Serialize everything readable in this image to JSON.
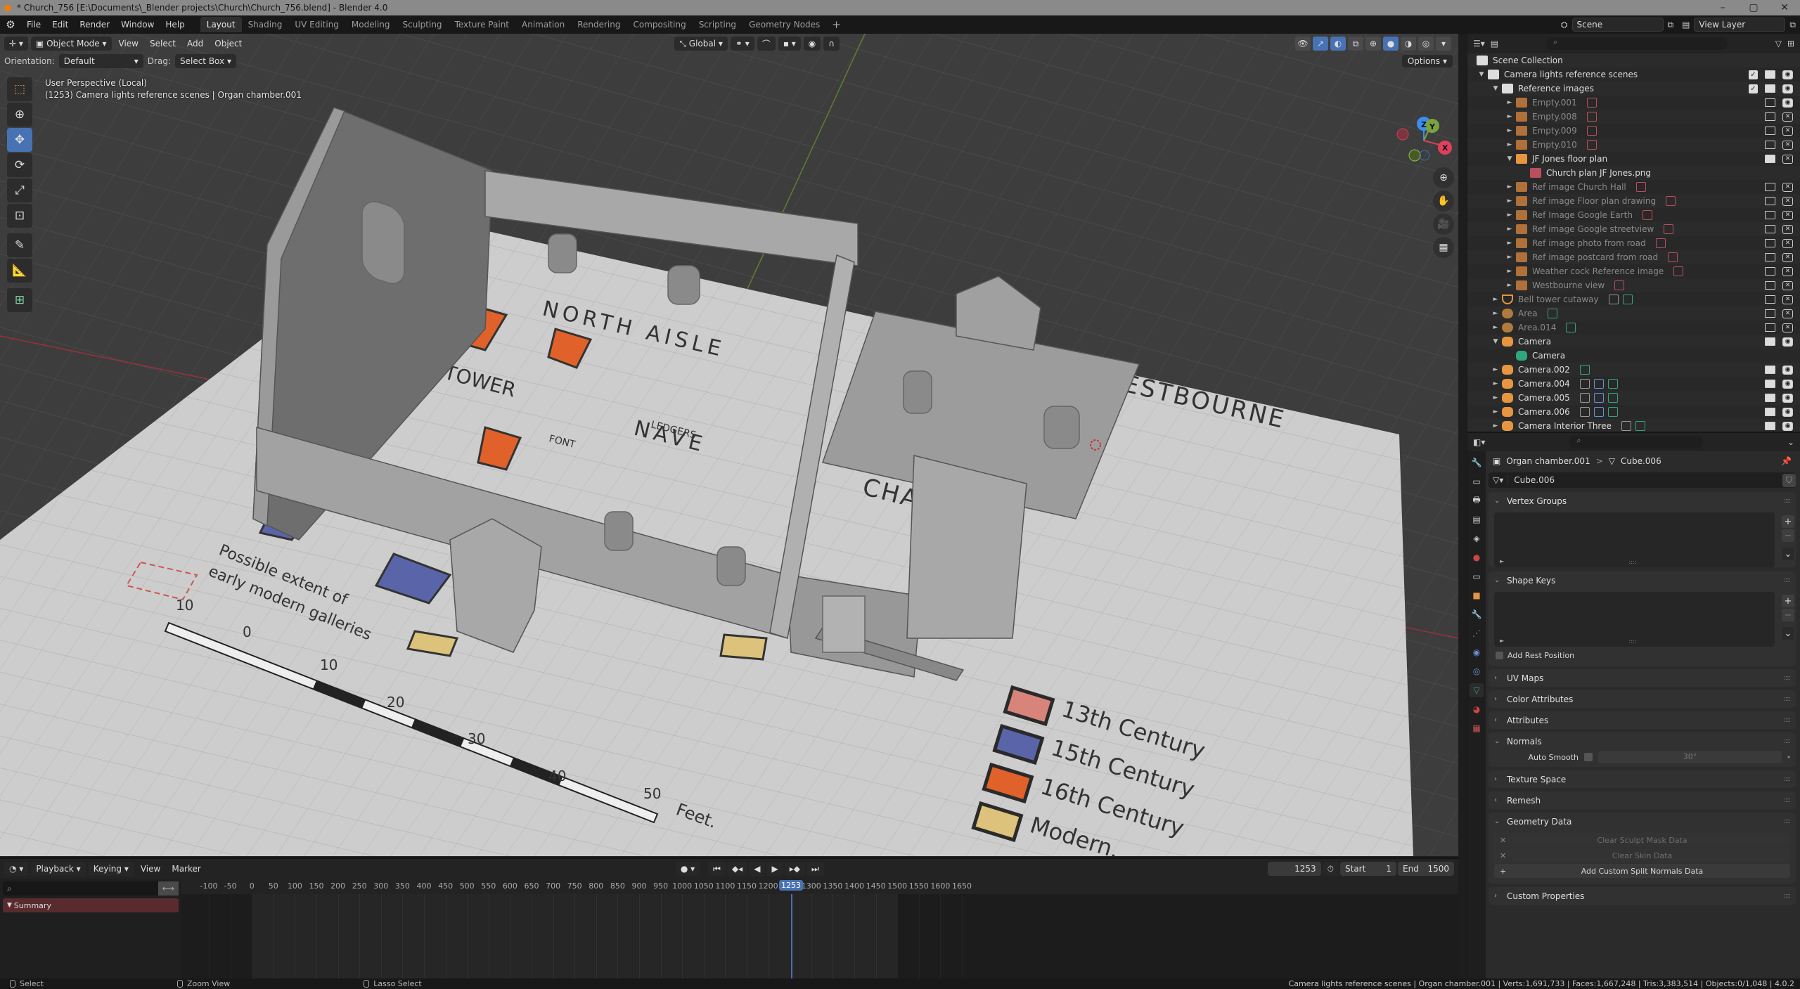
{
  "window": {
    "title": "* Church_756 [E:\\Documents\\_Blender projects\\Church\\Church_756.blend] - Blender 4.0",
    "controls": [
      "–",
      "▢",
      "✕"
    ]
  },
  "menubar": {
    "menus": [
      "File",
      "Edit",
      "Render",
      "Window",
      "Help"
    ],
    "workspaces": [
      "Layout",
      "Shading",
      "UV Editing",
      "Modeling",
      "Sculpting",
      "Texture Paint",
      "Animation",
      "Rendering",
      "Compositing",
      "Scripting",
      "Geometry Nodes"
    ],
    "active_workspace": "Layout",
    "add_workspace": "+",
    "scene": "Scene",
    "view_layer": "View Layer"
  },
  "viewport": {
    "mode": "Object Mode",
    "menus": [
      "View",
      "Select",
      "Add",
      "Object"
    ],
    "transform_orientation": "Global",
    "orientation_label": "Orientation:",
    "orientation_value": "Default",
    "drag_label": "Drag:",
    "drag_value": "Select Box",
    "options_label": "Options",
    "view_name": "User Perspective (Local)",
    "view_context": "(1253) Camera lights reference scenes | Organ chamber.001",
    "gizmo_axes": [
      "X",
      "Y",
      "Z"
    ],
    "scene_labels": {
      "north_aisle": "NORTH AISLE",
      "tower": "TOWER",
      "nave": "NAVE",
      "font": "FONT",
      "ledgers": "LEDGERS",
      "chancel": "CHANCEL",
      "westbourne": "WESTBOURNE",
      "galleries_note": [
        "Possible extent of",
        "early modern galleries"
      ],
      "scale_ticks": [
        "10",
        "0",
        "10",
        "20",
        "30",
        "40",
        "50"
      ],
      "scale_unit": "Feet."
    },
    "legend": [
      {
        "label": "13th Century",
        "color": "#d9847a"
      },
      {
        "label": "15th Century",
        "color": "#5a64a8"
      },
      {
        "label": "16th Century",
        "color": "#e0622a"
      },
      {
        "label": "Modern.",
        "color": "#dcc27a"
      }
    ]
  },
  "outliner": {
    "root": "Scene Collection",
    "rows": [
      {
        "label": "Camera lights reference scenes",
        "depth": 0,
        "expand": "▼",
        "icon": "collection",
        "dim": false,
        "check": true,
        "monitor": true,
        "camera": true
      },
      {
        "label": "Reference images",
        "depth": 1,
        "expand": "▼",
        "icon": "collection",
        "dim": false,
        "check": true,
        "monitor": true,
        "camera": true
      },
      {
        "label": "Empty.001",
        "depth": 2,
        "expand": "►",
        "icon": "image-empty",
        "dim": true,
        "extras": [
          "image-data"
        ],
        "monitor": false,
        "camera": true
      },
      {
        "label": "Empty.008",
        "depth": 2,
        "expand": "►",
        "icon": "image-empty",
        "dim": true,
        "extras": [
          "image-data"
        ],
        "monitor": false,
        "camera": false
      },
      {
        "label": "Empty.009",
        "depth": 2,
        "expand": "►",
        "icon": "image-empty",
        "dim": true,
        "extras": [
          "image-data"
        ],
        "monitor": false,
        "camera": false
      },
      {
        "label": "Empty.010",
        "depth": 2,
        "expand": "►",
        "icon": "image-empty",
        "dim": true,
        "extras": [
          "image-data"
        ],
        "monitor": false,
        "camera": false
      },
      {
        "label": "JF Jones floor plan",
        "depth": 2,
        "expand": "▼",
        "icon": "image-empty-active",
        "dim": false,
        "monitor": true,
        "camera": false
      },
      {
        "label": "Church plan JF Jones.png",
        "depth": 3,
        "expand": "",
        "icon": "image-data",
        "dim": false
      },
      {
        "label": "Ref image Church Hall",
        "depth": 2,
        "expand": "►",
        "icon": "image-empty",
        "dim": true,
        "extras": [
          "image-data"
        ],
        "monitor": false,
        "camera": false
      },
      {
        "label": "Ref image Floor plan drawing",
        "depth": 2,
        "expand": "►",
        "icon": "image-empty",
        "dim": true,
        "extras": [
          "image-data"
        ],
        "monitor": false,
        "camera": false
      },
      {
        "label": "Ref Image Google Earth",
        "depth": 2,
        "expand": "►",
        "icon": "image-empty",
        "dim": true,
        "extras": [
          "image-data"
        ],
        "monitor": false,
        "camera": false
      },
      {
        "label": "Ref image Google streetview",
        "depth": 2,
        "expand": "►",
        "icon": "image-empty",
        "dim": true,
        "extras": [
          "image-data"
        ],
        "monitor": false,
        "camera": false
      },
      {
        "label": "Ref image photo from road",
        "depth": 2,
        "expand": "►",
        "icon": "image-empty",
        "dim": true,
        "extras": [
          "image-data"
        ],
        "monitor": false,
        "camera": false
      },
      {
        "label": "Ref image postcard from road",
        "depth": 2,
        "expand": "►",
        "icon": "image-empty",
        "dim": true,
        "extras": [
          "image-data"
        ],
        "monitor": false,
        "camera": false
      },
      {
        "label": "Weather cock Reference image",
        "depth": 2,
        "expand": "►",
        "icon": "image-empty",
        "dim": true,
        "extras": [
          "image-data"
        ],
        "monitor": false,
        "camera": false
      },
      {
        "label": "Westbourne view",
        "depth": 2,
        "expand": "►",
        "icon": "image-empty",
        "dim": true,
        "extras": [
          "image-data"
        ],
        "monitor": false,
        "camera": false
      },
      {
        "label": "Bell tower cutaway",
        "depth": 1,
        "expand": "►",
        "icon": "mesh",
        "dim": true,
        "extras": [
          "modifier",
          "mesh-data"
        ],
        "monitor": false,
        "camera": false
      },
      {
        "label": "Area",
        "depth": 1,
        "expand": "►",
        "icon": "light",
        "dim": true,
        "extras": [
          "light-data"
        ],
        "monitor": false,
        "camera": false
      },
      {
        "label": "Area.014",
        "depth": 1,
        "expand": "►",
        "icon": "light",
        "dim": true,
        "extras": [
          "light-data"
        ],
        "monitor": false,
        "camera": false
      },
      {
        "label": "Camera",
        "depth": 1,
        "expand": "▼",
        "icon": "camera",
        "dim": false,
        "monitor": true,
        "camera": true
      },
      {
        "label": "Camera",
        "depth": 2,
        "expand": "",
        "icon": "camera-data",
        "dim": false
      },
      {
        "label": "Camera.002",
        "depth": 1,
        "expand": "►",
        "icon": "camera",
        "dim": false,
        "extras": [
          "camera-data"
        ],
        "monitor": true,
        "camera": true
      },
      {
        "label": "Camera.004",
        "depth": 1,
        "expand": "►",
        "icon": "camera",
        "dim": false,
        "extras": [
          "modifier",
          "constraint",
          "camera-data"
        ],
        "monitor": true,
        "camera": true
      },
      {
        "label": "Camera.005",
        "depth": 1,
        "expand": "►",
        "icon": "camera",
        "dim": false,
        "extras": [
          "modifier",
          "constraint",
          "camera-data"
        ],
        "monitor": true,
        "camera": true
      },
      {
        "label": "Camera.006",
        "depth": 1,
        "expand": "►",
        "icon": "camera",
        "dim": false,
        "extras": [
          "modifier",
          "constraint",
          "camera-data"
        ],
        "monitor": true,
        "camera": true
      },
      {
        "label": "Camera Interior Three",
        "depth": 1,
        "expand": "►",
        "icon": "camera",
        "dim": false,
        "extras": [
          "modifier",
          "camera-data"
        ],
        "monitor": true,
        "camera": true
      }
    ]
  },
  "properties": {
    "breadcrumb_object": "Organ chamber.001",
    "breadcrumb_separator": ">",
    "breadcrumb_mesh": "Cube.006",
    "mesh_name": "Cube.006",
    "panels": {
      "vertex_groups": "Vertex Groups",
      "shape_keys": "Shape Keys",
      "add_rest_position": "Add Rest Position",
      "uv_maps": "UV Maps",
      "color_attributes": "Color Attributes",
      "attributes": "Attributes",
      "normals": "Normals",
      "auto_smooth_label": "Auto Smooth",
      "auto_smooth_angle": "30°",
      "texture_space": "Texture Space",
      "remesh": "Remesh",
      "geometry_data": "Geometry Data",
      "clear_sculpt_mask": "Clear Sculpt Mask Data",
      "clear_skin": "Clear Skin Data",
      "add_custom_split_normals": "Add Custom Split Normals Data",
      "custom_properties": "Custom Properties"
    },
    "tabs": [
      "tool",
      "render",
      "output",
      "view-layer",
      "scene",
      "world",
      "collection",
      "object",
      "modifiers",
      "particles",
      "physics",
      "constraints",
      "data",
      "material",
      "texture"
    ],
    "active_tab": "data"
  },
  "timeline": {
    "menus": [
      "Playback",
      "Keying",
      "View",
      "Marker"
    ],
    "summary": "Summary",
    "current_frame": "1253",
    "start_label": "Start",
    "start": "1",
    "end_label": "End",
    "end": "1500",
    "ticks": [
      "-100",
      "-50",
      "0",
      "50",
      "100",
      "150",
      "200",
      "250",
      "300",
      "350",
      "400",
      "450",
      "500",
      "550",
      "600",
      "650",
      "700",
      "750",
      "800",
      "850",
      "900",
      "950",
      "1000",
      "1050",
      "1100",
      "1150",
      "1200",
      "1300",
      "1350",
      "1400",
      "1450",
      "1500",
      "1550",
      "1600",
      "1650"
    ],
    "playback_buttons": [
      "jump-start",
      "prev-keyframe",
      "play-reverse",
      "play",
      "next-keyframe",
      "jump-end"
    ]
  },
  "statusbar": {
    "hints": [
      "Select",
      "Zoom View",
      "Lasso Select"
    ],
    "info": "Camera lights reference scenes | Organ chamber.001 | Verts:1,691,733 | Faces:1,667,248 | Tris:3,383,514 | Objects:0/1,048 | 4.0.2"
  },
  "colors": {
    "accent": "#4772b3",
    "object_orange": "#e69540",
    "data_green": "#2fa77d",
    "image_red": "#b94f5e",
    "summary_red": "#5a2b2e"
  }
}
